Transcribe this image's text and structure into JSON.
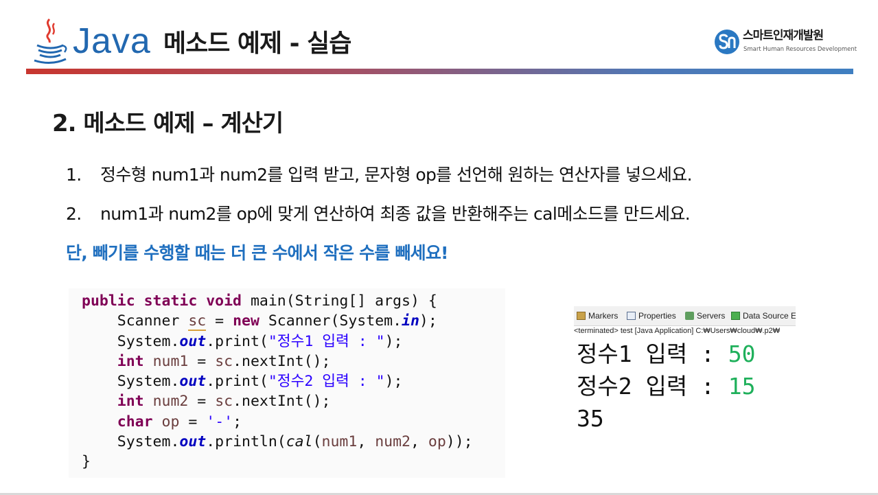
{
  "header": {
    "logo_text": "Java",
    "title": "메소드 예제 - 실습",
    "brand": {
      "name": "스마트인재개발원",
      "tagline": "Smart Human Resources Development"
    }
  },
  "section": {
    "title": "2. 메소드 예제 – 계산기"
  },
  "instructions": [
    {
      "number": "1.",
      "text": "정수형 num1과 num2를 입력 받고, 문자형 op를 선언해 원하는 연산자를 넣으세요."
    },
    {
      "number": "2.",
      "text": "num1과 num2를 op에 맞게 연산하여 최종 값을 반환해주는 cal메소드를 만드세요."
    }
  ],
  "note": "단, 빼기를 수행할 때는 더 큰 수에서 작은 수를 빼세요!",
  "code": {
    "main_signature": "main(String[] args) {",
    "prompt1": "\"정수1 입력 : \"",
    "prompt2": "\"정수2 입력 : \"",
    "op_value": "'-'"
  },
  "console": {
    "tabs": [
      "Markers",
      "Properties",
      "Servers",
      "Data Source E"
    ],
    "status": "<terminated> test [Java Application] C:₩Users₩cloud₩.p2₩",
    "lines": [
      {
        "prompt": "정수1 입력 : ",
        "input": "50"
      },
      {
        "prompt": "정수2 입력 : ",
        "input": "15"
      },
      {
        "prompt": "35",
        "input": ""
      }
    ]
  },
  "colors": {
    "java_blue": "#2268b0",
    "note_blue": "#1f6fbf",
    "keyword": "#7f0055",
    "string": "#2a00ff",
    "console_input": "#1fb05b"
  }
}
